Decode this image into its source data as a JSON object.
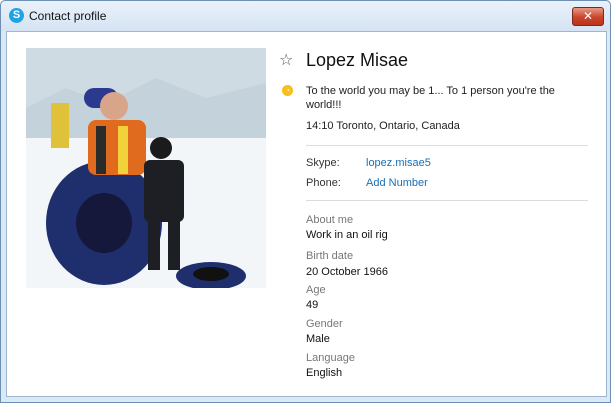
{
  "window": {
    "title": "Contact profile",
    "app_icon_glyph": "S",
    "close_glyph": "✕"
  },
  "profile": {
    "name": "Lopez Misae",
    "mood": "To the world you may be 1... To 1 person you're the world!!!",
    "local_time": "14:10 Toronto, Ontario, Canada"
  },
  "contact": {
    "skype_label": "Skype:",
    "skype_value": "lopez.misae5",
    "phone_label": "Phone:",
    "phone_value": "Add Number"
  },
  "details": [
    {
      "label": "About me",
      "value": "Work in an oil rig"
    },
    {
      "label": "Birth date",
      "value": "20 October 1966"
    },
    {
      "label": "Age",
      "value": "49"
    },
    {
      "label": "Gender",
      "value": "Male"
    },
    {
      "label": "Language",
      "value": "English"
    }
  ],
  "icons": {
    "star": "favorite-star-icon",
    "mood": "clock-icon",
    "app": "skype-icon",
    "close": "close-icon"
  },
  "colors": {
    "link": "#1a6fb5",
    "accent": "#1fa3e6",
    "mood_icon": "#f6be1f",
    "close": "#c9442b"
  }
}
